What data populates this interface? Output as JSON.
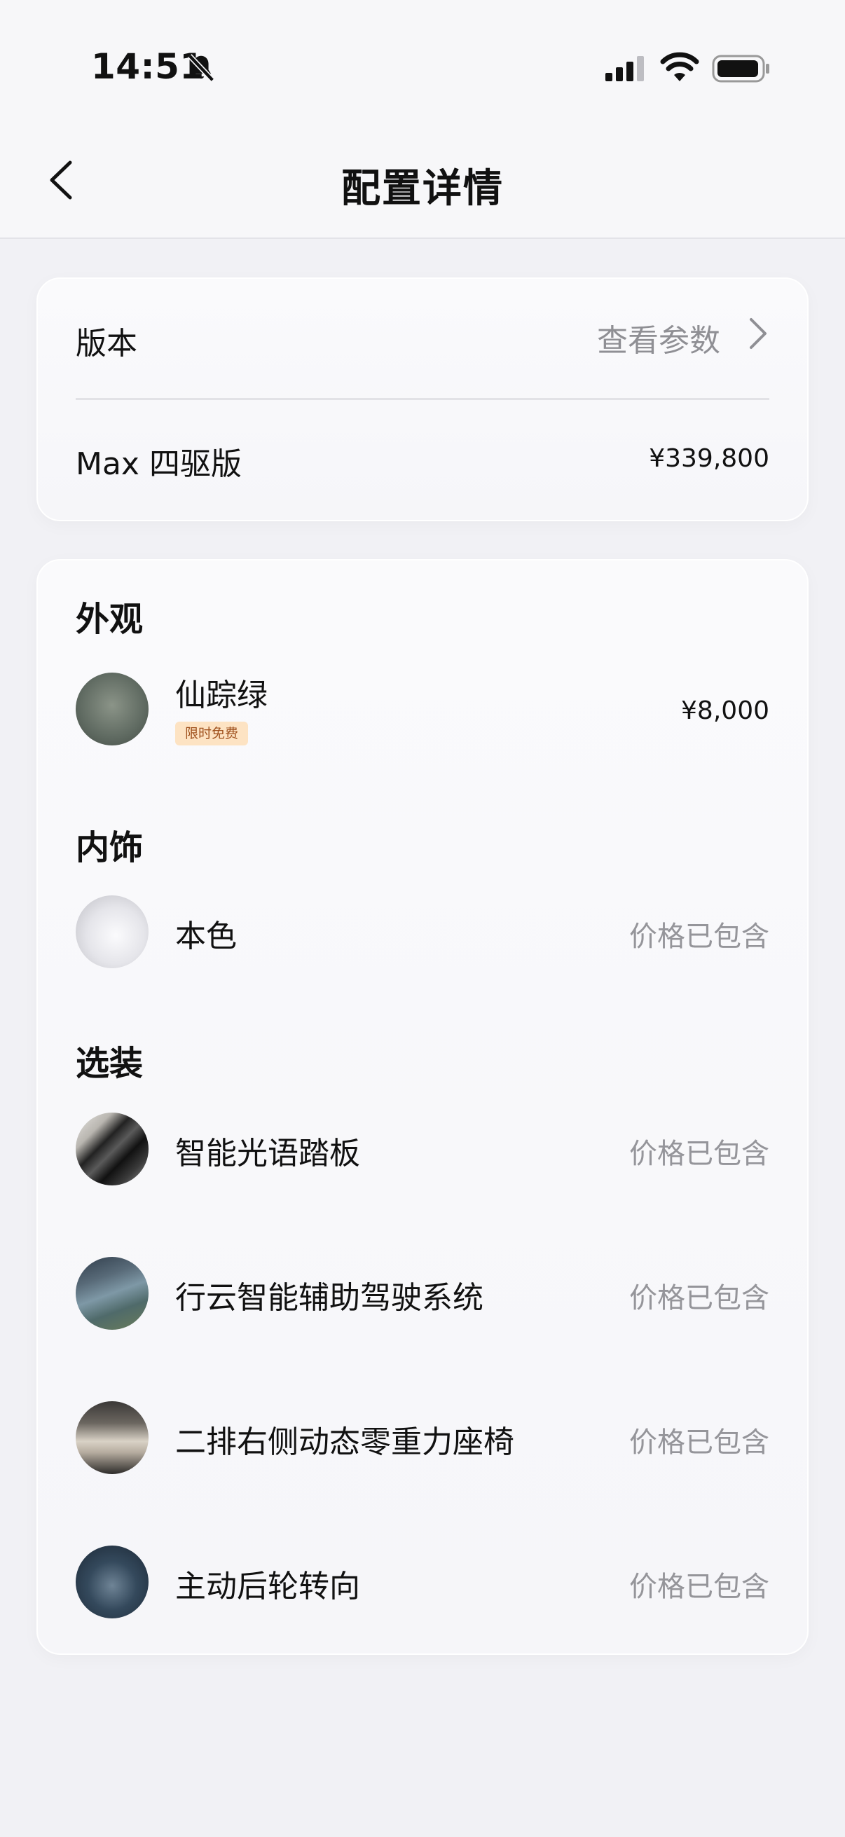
{
  "status_bar": {
    "time": "14:51",
    "icons": [
      "bell-slash-icon",
      "cellular-signal-icon",
      "wifi-icon",
      "battery-icon"
    ]
  },
  "nav": {
    "title": "配置详情",
    "back_icon": "chevron-left-icon"
  },
  "version_card": {
    "label": "版本",
    "link_text": "查看参数",
    "link_icon": "chevron-right-icon",
    "version_name": "Max 四驱版",
    "version_price": "¥339,800"
  },
  "exterior": {
    "title": "外观",
    "item": {
      "name": "仙踪绿",
      "badge": "限时免费",
      "price": "¥8,000",
      "color": "#6b756c"
    }
  },
  "interior": {
    "title": "内饰",
    "item": {
      "name": "本色",
      "price": "价格已包含",
      "color": "#e2e2e6"
    }
  },
  "options": {
    "title": "选装",
    "items": [
      {
        "name": "智能光语踏板",
        "price": "价格已包含"
      },
      {
        "name": "行云智能辅助驾驶系统",
        "price": "价格已包含"
      },
      {
        "name": "二排右侧动态零重力座椅",
        "price": "价格已包含"
      },
      {
        "name": "主动后轮转向",
        "price": "价格已包含"
      }
    ]
  }
}
